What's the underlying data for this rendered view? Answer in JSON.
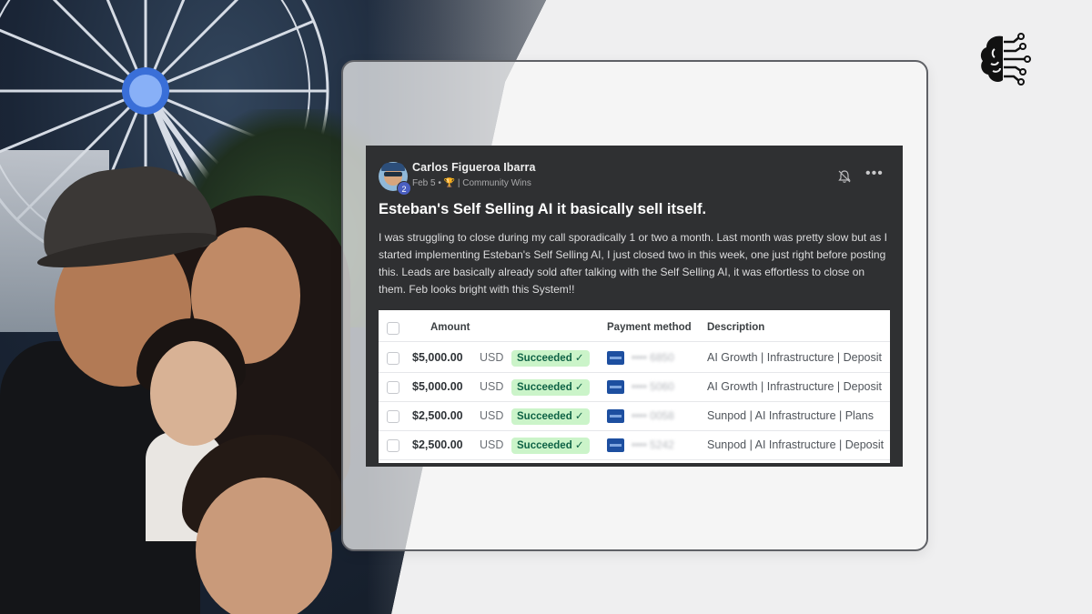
{
  "post": {
    "author": "Carlos Figueroa Ibarra",
    "level": "2",
    "date": "Feb 5",
    "separator": "•",
    "trophy": "🏆",
    "category": "| Community Wins",
    "title": "Esteban's Self Selling AI it basically sell itself.",
    "body": "I was struggling to close during my call sporadically 1 or two a month. Last month was pretty slow but as I started implementing Esteban's Self Selling AI, I just closed two in this week, one just right before posting this. Leads are basically already sold after talking with the Self Selling AI, it was effortless to close on them. Feb looks bright with this System!!",
    "icons": [
      "bell-icon",
      "more-options-icon"
    ]
  },
  "table": {
    "headers": {
      "amount": "Amount",
      "payment_method": "Payment method",
      "description": "Description"
    },
    "rows": [
      {
        "amount": "$5,000.00",
        "currency": "USD",
        "status": "Succeeded ✓",
        "card_masked": "•••• 6850",
        "description": "AI Growth | Infrastructure | Deposit"
      },
      {
        "amount": "$5,000.00",
        "currency": "USD",
        "status": "Succeeded ✓",
        "card_masked": "•••• 5060",
        "description": "AI Growth | Infrastructure | Deposit"
      },
      {
        "amount": "$2,500.00",
        "currency": "USD",
        "status": "Succeeded ✓",
        "card_masked": "•••• 0058",
        "description": "Sunpod | AI Infrastructure | Plans"
      },
      {
        "amount": "$2,500.00",
        "currency": "USD",
        "status": "Succeeded ✓",
        "card_masked": "•••• 5242",
        "description": "Sunpod | AI Infrastructure | Deposit"
      }
    ]
  },
  "colors": {
    "post_background": "#2f3032",
    "status_badge_bg": "#cbf4c9",
    "status_badge_text": "#0e6245",
    "card_brand": "#1d4fa0",
    "card_border": "#5f6166",
    "page_background": "#efeff0"
  },
  "logo_icon": "brain-circuit-icon"
}
